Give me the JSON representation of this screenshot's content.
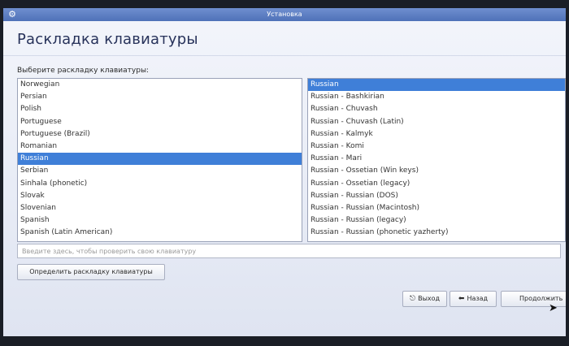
{
  "window": {
    "title": "Установка"
  },
  "page": {
    "title": "Раскладка клавиатуры",
    "prompt": "Выберите раскладку клавиатуры:"
  },
  "layouts": {
    "items": [
      "Norwegian",
      "Persian",
      "Polish",
      "Portuguese",
      "Portuguese (Brazil)",
      "Romanian",
      "Russian",
      "Serbian",
      "Sinhala (phonetic)",
      "Slovak",
      "Slovenian",
      "Spanish",
      "Spanish (Latin American)"
    ],
    "selected": "Russian"
  },
  "variants": {
    "items": [
      "Russian",
      "Russian - Bashkirian",
      "Russian - Chuvash",
      "Russian - Chuvash (Latin)",
      "Russian - Kalmyk",
      "Russian - Komi",
      "Russian - Mari",
      "Russian - Ossetian (Win keys)",
      "Russian - Ossetian (legacy)",
      "Russian - Russian (DOS)",
      "Russian - Russian (Macintosh)",
      "Russian - Russian (legacy)",
      "Russian - Russian (phonetic yazherty)"
    ],
    "selected": "Russian"
  },
  "test_field": {
    "placeholder": "Введите здесь, чтобы проверить свою клавиатуру",
    "value": ""
  },
  "buttons": {
    "detect": "Определить раскладку клавиатуры",
    "exit": "Выход",
    "back": "Назад",
    "next": "Продолжить"
  },
  "icons": {
    "exit": "exit-icon",
    "back": "left-arrow-icon",
    "app": "installer-icon"
  },
  "colors": {
    "selection": "#3f7fd8",
    "titlebar": "#4f71b8",
    "heading": "#27325a"
  }
}
